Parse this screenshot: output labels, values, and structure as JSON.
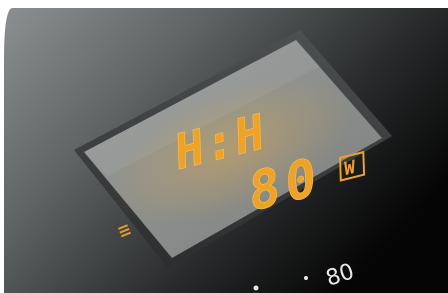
{
  "display": {
    "time": "H:H",
    "power": "80",
    "unit": "W",
    "segment_color": "#f0a322"
  },
  "panel": {
    "scale_label": "80"
  }
}
